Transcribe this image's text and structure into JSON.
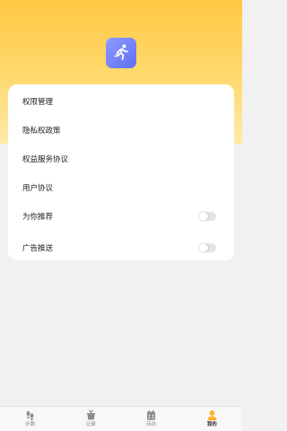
{
  "colors": {
    "header_top": "#ffc844",
    "header_bottom": "#ffeaa6",
    "logo": "#6b78f5",
    "active_tab": "#ffb02e",
    "inactive_tab": "#8a8a8a",
    "page_bg": "#f1f1f1"
  },
  "header": {
    "logo_icon": "running-man-icon"
  },
  "menu": {
    "items": [
      {
        "label": "权限管理"
      },
      {
        "label": "隐私权政策"
      },
      {
        "label": "权益服务协议"
      },
      {
        "label": "用户协议"
      },
      {
        "label": "为你推荐",
        "toggle": false
      },
      {
        "label": "广告推送",
        "toggle": false
      }
    ]
  },
  "tabbar": {
    "tabs": [
      {
        "label": "步数",
        "icon": "footprint-icon",
        "active": false
      },
      {
        "label": "记录",
        "icon": "pot-icon",
        "active": false
      },
      {
        "label": "待办",
        "icon": "calendar-icon",
        "active": false
      },
      {
        "label": "我的",
        "icon": "person-icon",
        "active": true
      }
    ]
  }
}
